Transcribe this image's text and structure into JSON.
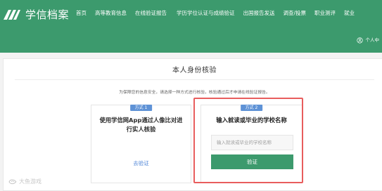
{
  "brand": {
    "name": "学信档案",
    "logo_icon": "xuexin-logo-icon"
  },
  "nav": {
    "items": [
      {
        "label": "首页"
      },
      {
        "label": "高等教育信息"
      },
      {
        "label": "在线验证报告"
      },
      {
        "label": "学历学位认证与成绩验证"
      },
      {
        "label": "出国报告发送"
      },
      {
        "label": "调查/投票"
      },
      {
        "label": "职业测评"
      },
      {
        "label": "就业"
      }
    ],
    "personal_label": "个人中",
    "personal_icon": "user-circle-icon"
  },
  "verification": {
    "title": "本人身份核验",
    "notice": "为保障您的信息安全，请选择一种方式进行核验，核验通过后才申请在线验证报告。",
    "method1": {
      "badge": "方式 1",
      "description": "使用学信网App通过人像比对进行实人核验",
      "action": "去验证"
    },
    "method2": {
      "badge": "方式 2",
      "title": "输入就读或毕业的学校名称",
      "input_value": "",
      "input_placeholder": "输入就读或毕业的学校名称",
      "button": "验证"
    }
  },
  "watermark": {
    "text": "大鱼游戏",
    "icon": "watermark-logo-icon"
  },
  "colors": {
    "primary_green": "#3c9a6d",
    "badge_blue": "#5e92d6",
    "link_blue": "#4f85d7",
    "highlight_red": "#e85d5d"
  }
}
